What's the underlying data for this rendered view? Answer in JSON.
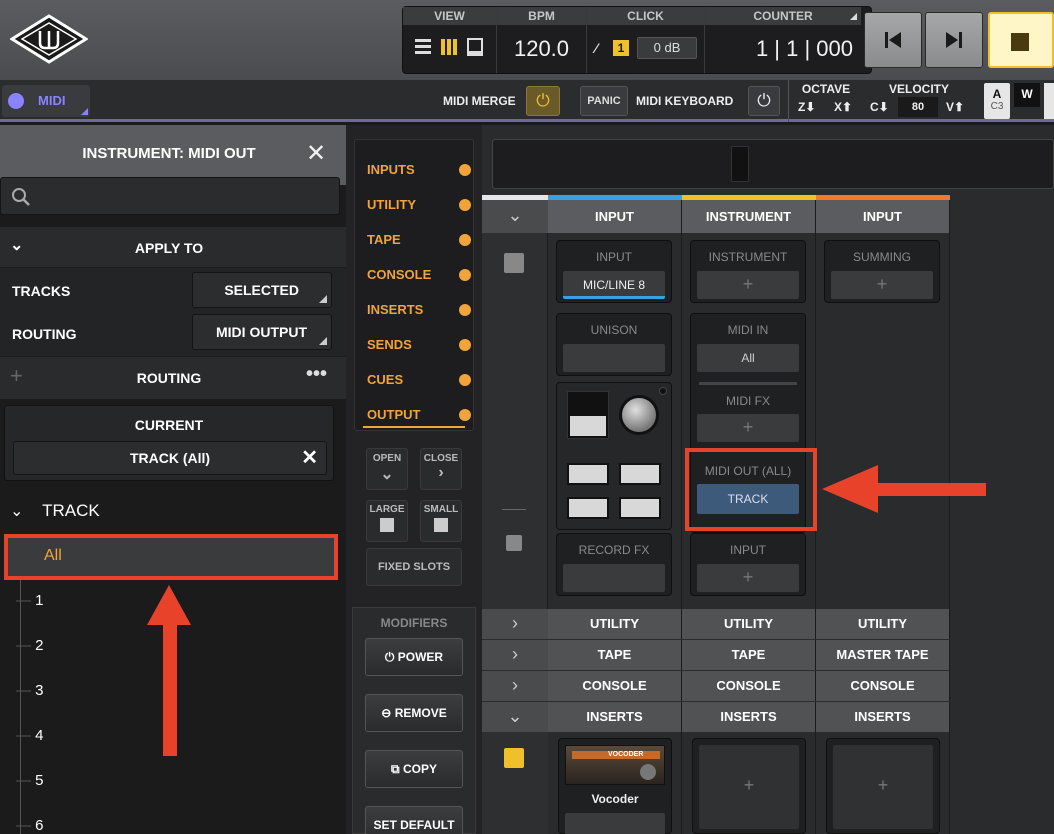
{
  "transport": {
    "view_label": "VIEW",
    "bpm_label": "BPM",
    "bpm_value": "120.0",
    "click_label": "CLICK",
    "click_level": "0 dB",
    "click_badge": "1",
    "counter_label": "COUNTER",
    "counter_value": "1 | 1 | 000"
  },
  "midi_bar": {
    "midi_button": "MIDI",
    "midi_merge": "MIDI MERGE",
    "panic": "PANIC",
    "midi_keyboard": "MIDI KEYBOARD",
    "octave_label": "OCTAVE",
    "octave_down": "Z",
    "octave_up": "X",
    "velocity_label": "VELOCITY",
    "velocity_down": "C",
    "velocity_value": "80",
    "velocity_up": "V",
    "key_a": "A",
    "key_a_note": "C3",
    "key_w": "W"
  },
  "sidebar": {
    "title": "INSTRUMENT: MIDI OUT",
    "apply_to": "APPLY TO",
    "tracks_label": "TRACKS",
    "tracks_value": "SELECTED",
    "routing_label": "ROUTING",
    "routing_value": "MIDI OUTPUT",
    "routing_header": "ROUTING",
    "current_label": "CURRENT",
    "current_value": "TRACK (All)",
    "track_header": "TRACK",
    "track_items": [
      "All",
      "1",
      "2",
      "3",
      "4",
      "5",
      "6"
    ]
  },
  "inspector_tabs": [
    "INPUTS",
    "UTILITY",
    "TAPE",
    "CONSOLE",
    "INSERTS",
    "SENDS",
    "CUES",
    "OUTPUT"
  ],
  "view_buttons": {
    "open": "OPEN",
    "close": "CLOSE",
    "large": "LARGE",
    "small": "SMALL",
    "fixed_slots": "FIXED SLOTS"
  },
  "modifiers": {
    "title": "MODIFIERS",
    "power": "POWER",
    "remove": "REMOVE",
    "copy": "COPY",
    "set_default": "SET DEFAULT"
  },
  "channels": {
    "headers": [
      "INPUT",
      "INSTRUMENT",
      "INPUT"
    ],
    "ch1": {
      "input_label": "INPUT",
      "input_value": "MIC/LINE 8",
      "unison_label": "UNISON",
      "record_fx_label": "RECORD FX"
    },
    "ch2": {
      "instrument_label": "INSTRUMENT",
      "midi_in_label": "MIDI IN",
      "midi_in_value": "All",
      "midi_fx_label": "MIDI FX",
      "midi_out_label": "MIDI OUT (ALL)",
      "midi_out_value": "TRACK",
      "input_label": "INPUT"
    },
    "ch3": {
      "summing_label": "SUMMING"
    },
    "rows": [
      [
        "UTILITY",
        "UTILITY",
        "UTILITY"
      ],
      [
        "TAPE",
        "TAPE",
        "MASTER TAPE"
      ],
      [
        "CONSOLE",
        "CONSOLE",
        "CONSOLE"
      ],
      [
        "INSERTS",
        "INSERTS",
        "INSERTS"
      ]
    ],
    "insert_plugin": "Vocoder",
    "insert_plugin_badge": "VOCODER"
  },
  "colors": {
    "accent_orange": "#f0a43a",
    "highlight_red": "#e8432a",
    "track_blue": "#3d5a7a",
    "midi_purple": "#8a83ff"
  }
}
